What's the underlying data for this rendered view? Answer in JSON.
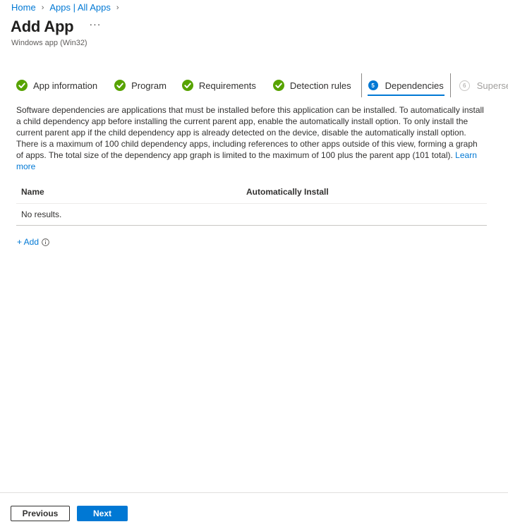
{
  "breadcrumb": {
    "items": [
      "Home",
      "Apps | All Apps"
    ]
  },
  "header": {
    "title": "Add App",
    "more_label": "···",
    "subtitle": "Windows app (Win32)"
  },
  "tabs": [
    {
      "label": "App information",
      "state": "complete",
      "icon": "check-circle-icon"
    },
    {
      "label": "Program",
      "state": "complete",
      "icon": "check-circle-icon"
    },
    {
      "label": "Requirements",
      "state": "complete",
      "icon": "check-circle-icon"
    },
    {
      "label": "Detection rules",
      "state": "complete",
      "icon": "check-circle-icon"
    },
    {
      "label": "Dependencies",
      "state": "active",
      "number": "5"
    },
    {
      "label": "Supersede",
      "state": "disabled",
      "number": "6"
    }
  ],
  "description": {
    "text": "Software dependencies are applications that must be installed before this application can be installed. To automatically install a child dependency app before installing the current parent app, enable the automatically install option. To only install the current parent app if the child dependency app is already detected on the device, disable the automatically install option. There is a maximum of 100 child dependency apps, including references to other apps outside of this view, forming a graph of apps. The total size of the dependency app graph is limited to the maximum of 100 plus the parent app (101 total).",
    "learn_more": "Learn more"
  },
  "table": {
    "columns": [
      "Name",
      "Automatically Install"
    ],
    "empty_text": "No results."
  },
  "add": {
    "label": "+ Add"
  },
  "footer": {
    "previous_label": "Previous",
    "next_label": "Next"
  },
  "colors": {
    "accent": "#0078d4",
    "success": "#57a300",
    "text": "#323130"
  }
}
